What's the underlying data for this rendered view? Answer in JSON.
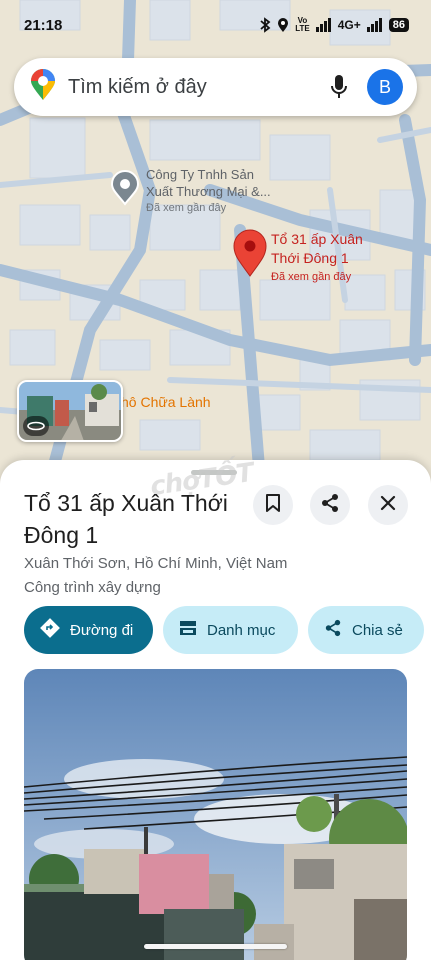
{
  "status_bar": {
    "time": "21:18",
    "network": "4G+",
    "lte_top": "Vo",
    "lte_bottom": "LTE",
    "battery": "86"
  },
  "search": {
    "placeholder": "Tìm kiếm ở đây",
    "avatar_letter": "B"
  },
  "map": {
    "poi_company": {
      "name_line1": "Công Ty Tnhh Sản",
      "name_line2": "Xuất Thương Mại &...",
      "sub": "Đã xem gần đây"
    },
    "pin": {
      "name_line1": "Tổ 31 ấp Xuân",
      "name_line2": "Thới Đông 1",
      "sub": "Đã xem gần đây"
    },
    "poi_orange": "hô Chữa Lành",
    "watermark": "chợTỐT"
  },
  "place": {
    "title": "Tổ 31 ấp Xuân Thới Đông 1",
    "address": "Xuân Thới Sơn, Hồ Chí Minh, Việt Nam",
    "category": "Công trình xây dựng"
  },
  "actions": {
    "directions": "Đường đi",
    "lists": "Danh mục",
    "share": "Chia sẻ"
  },
  "colors": {
    "accent": "#0b6e8e",
    "chip_bg": "#c6ecf7",
    "pin": "#ea4335",
    "avatar": "#1a73e8"
  }
}
